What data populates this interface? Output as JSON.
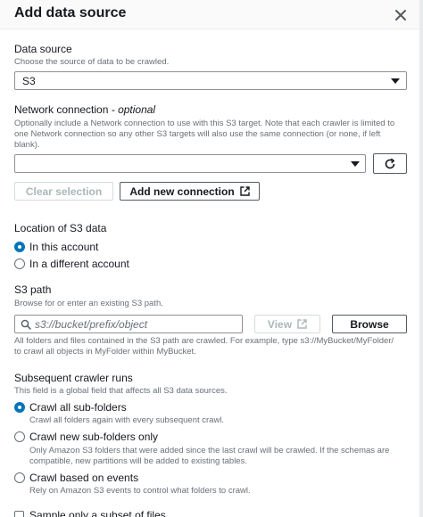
{
  "modal": {
    "title": "Add data source"
  },
  "data_source": {
    "label": "Data source",
    "description": "Choose the source of data to be crawled.",
    "selected": "S3"
  },
  "network_connection": {
    "label": "Network connection",
    "optional": "- optional",
    "description_line1": "Optionally include a Network connection to use with this S3 target. Note that each crawler is limited to",
    "description_line2": "one Network connection so any other S3 targets will also use the same connection (or none, if left",
    "description_line3": "blank).",
    "selected": "",
    "clear_label": "Clear selection",
    "add_label": "Add new connection"
  },
  "location": {
    "label": "Location of S3 data",
    "options": [
      {
        "label": "In this account",
        "checked": true
      },
      {
        "label": "In a different account",
        "checked": false
      }
    ]
  },
  "s3_path": {
    "label": "S3 path",
    "description": "Browse for or enter an existing S3 path.",
    "placeholder": "s3://bucket/prefix/object",
    "view_label": "View",
    "browse_label": "Browse",
    "help_line1": "All folders and files contained in the S3 path are crawled. For example, type s3://MyBucket/MyFolder/",
    "help_line2": "to crawl all objects in MyFolder within MyBucket."
  },
  "subsequent_runs": {
    "label": "Subsequent crawler runs",
    "description": "This field is a global field that affects all S3 data sources.",
    "options": [
      {
        "label": "Crawl all sub-folders",
        "desc1": "Crawl all folders again with every subsequent crawl.",
        "desc2": "",
        "checked": true
      },
      {
        "label": "Crawl new sub-folders only",
        "desc1": "Only Amazon S3 folders that were added since the last crawl will be crawled. If the schemas are",
        "desc2": "compatible, new partitions will be added to existing tables.",
        "checked": false
      },
      {
        "label": "Crawl based on events",
        "desc1": "Rely on Amazon S3 events to control what folders to crawl.",
        "desc2": "",
        "checked": false
      }
    ]
  },
  "sample": {
    "label": "Sample only a subset of files"
  }
}
